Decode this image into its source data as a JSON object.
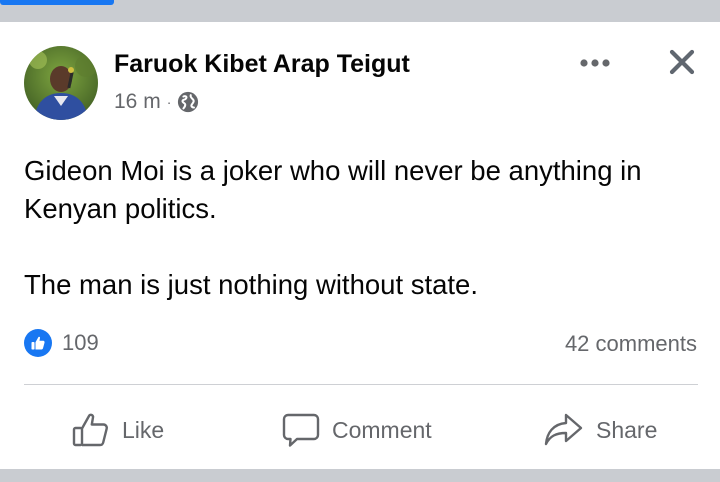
{
  "post": {
    "author": "Faruok Kibet Arap Teigut",
    "time": "16 m",
    "separator": "·",
    "privacy_icon": "globe-icon",
    "paragraphs": [
      "Gideon Moi is a joker who will never be anything in Kenyan politics.",
      "The man is just nothing without state."
    ],
    "reaction_count": "109",
    "reaction_icon": "like-reaction-icon",
    "comments": "42 comments"
  },
  "actions": {
    "like": "Like",
    "comment": "Comment",
    "share": "Share"
  },
  "colors": {
    "brand": "#1877f2",
    "text": "#050505",
    "secondary_text": "#65676b",
    "separator": "#c9ccd1"
  }
}
